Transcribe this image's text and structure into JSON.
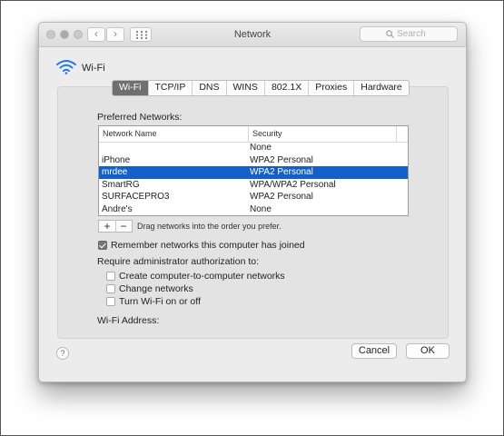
{
  "window": {
    "title": "Network"
  },
  "search": {
    "placeholder": "Search"
  },
  "nav": {
    "back": "‹",
    "forward": "›"
  },
  "section": {
    "title": "Wi-Fi"
  },
  "tabs": [
    {
      "label": "Wi-Fi",
      "active": true
    },
    {
      "label": "TCP/IP",
      "active": false
    },
    {
      "label": "DNS",
      "active": false
    },
    {
      "label": "WINS",
      "active": false
    },
    {
      "label": "802.1X",
      "active": false
    },
    {
      "label": "Proxies",
      "active": false
    },
    {
      "label": "Hardware",
      "active": false
    }
  ],
  "preferred": {
    "label": "Preferred Networks:",
    "columns": {
      "name": "Network Name",
      "security": "Security"
    },
    "rows": [
      {
        "name": "",
        "security": "None",
        "selected": false
      },
      {
        "name": "iPhone",
        "security": "WPA2 Personal",
        "selected": false
      },
      {
        "name": "mrdee",
        "security": "WPA2 Personal",
        "selected": true
      },
      {
        "name": "SmartRG",
        "security": "WPA/WPA2 Personal",
        "selected": false
      },
      {
        "name": "SURFACEPRO3",
        "security": "WPA2 Personal",
        "selected": false
      },
      {
        "name": "Andre's",
        "security": "None",
        "selected": false
      }
    ],
    "add": "+",
    "remove": "−",
    "hint": "Drag networks into the order you prefer."
  },
  "remember": {
    "label": "Remember networks this computer has joined",
    "checked": true
  },
  "admin": {
    "label": "Require administrator authorization to:",
    "options": [
      {
        "label": "Create computer-to-computer networks",
        "checked": false
      },
      {
        "label": "Change networks",
        "checked": false
      },
      {
        "label": "Turn Wi-Fi on or off",
        "checked": false
      }
    ]
  },
  "address": {
    "label": "Wi-Fi Address:"
  },
  "help": "?",
  "buttons": {
    "cancel": "Cancel",
    "ok": "OK"
  },
  "colors": {
    "selection": "#1460c8",
    "active_tab": "#6f6f6f",
    "wifi_icon": "#1f7ae0"
  }
}
